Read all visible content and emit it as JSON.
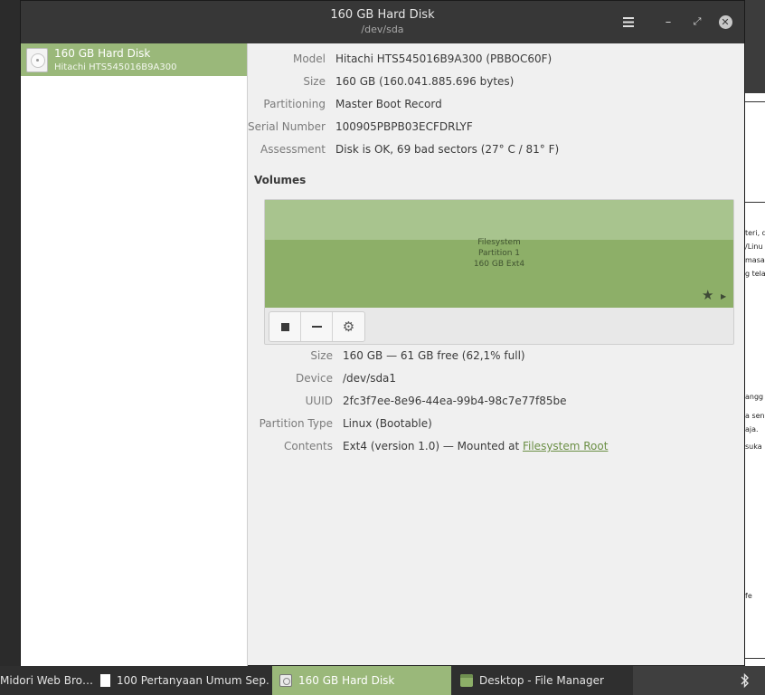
{
  "window": {
    "title": "160 GB Hard Disk",
    "subtitle": "/dev/sda",
    "menu_icon": "hamburger-menu-icon",
    "min_glyph": "–",
    "max_glyph": "⤢",
    "close_glyph": "✕"
  },
  "sidebar": {
    "items": [
      {
        "name": "160 GB Hard Disk",
        "model": "Hitachi HTS545016B9A300",
        "icon": "hard-disk-icon",
        "selected": true
      }
    ]
  },
  "drive": {
    "model_label": "Model",
    "model_value": "Hitachi HTS545016B9A300 (PBBOC60F)",
    "size_label": "Size",
    "size_value": "160 GB (160.041.885.696 bytes)",
    "partitioning_label": "Partitioning",
    "partitioning_value": "Master Boot Record",
    "serial_label": "Serial Number",
    "serial_value": "100905PBPB03ECFDRLYF",
    "assessment_label": "Assessment",
    "assessment_value": "Disk is OK, 69 bad sectors (27° C / 81° F)"
  },
  "volumes": {
    "heading": "Volumes",
    "partition": {
      "line1": "Filesystem",
      "line2": "Partition 1",
      "line3": "160 GB Ext4",
      "color": "#8daf68"
    },
    "star_glyph": "★",
    "arrow_glyph": "▶"
  },
  "volume_details": {
    "size_label": "Size",
    "size_value": "160 GB — 61 GB free (62,1% full)",
    "device_label": "Device",
    "device_value": "/dev/sda1",
    "uuid_label": "UUID",
    "uuid_value": "2fc3f7ee-8e96-44ea-99b4-98c7e77f85be",
    "partition_type_label": "Partition Type",
    "partition_type_value": "Linux (Bootable)",
    "contents_label": "Contents",
    "contents_value": "Ext4 (version 1.0) — Mounted at ",
    "contents_link": "Filesystem Root"
  },
  "taskbar": {
    "items": [
      {
        "label": "Midori Web Bro…"
      },
      {
        "label": "100 Pertanyaan Umum Sep…"
      },
      {
        "label": "160 GB Hard Disk",
        "active": true
      },
      {
        "label": "Desktop - File Manager"
      }
    ],
    "bluetooth_glyph": "✱"
  },
  "background_window": {
    "fragments": [
      "teri, d",
      "/Linu",
      "masa",
      "g tela",
      "angg",
      "a send",
      "aja.",
      "suka",
      "fe"
    ]
  },
  "colors": {
    "accent": "#9ab87a",
    "titlebar": "#373737",
    "link": "#6b8f45"
  }
}
